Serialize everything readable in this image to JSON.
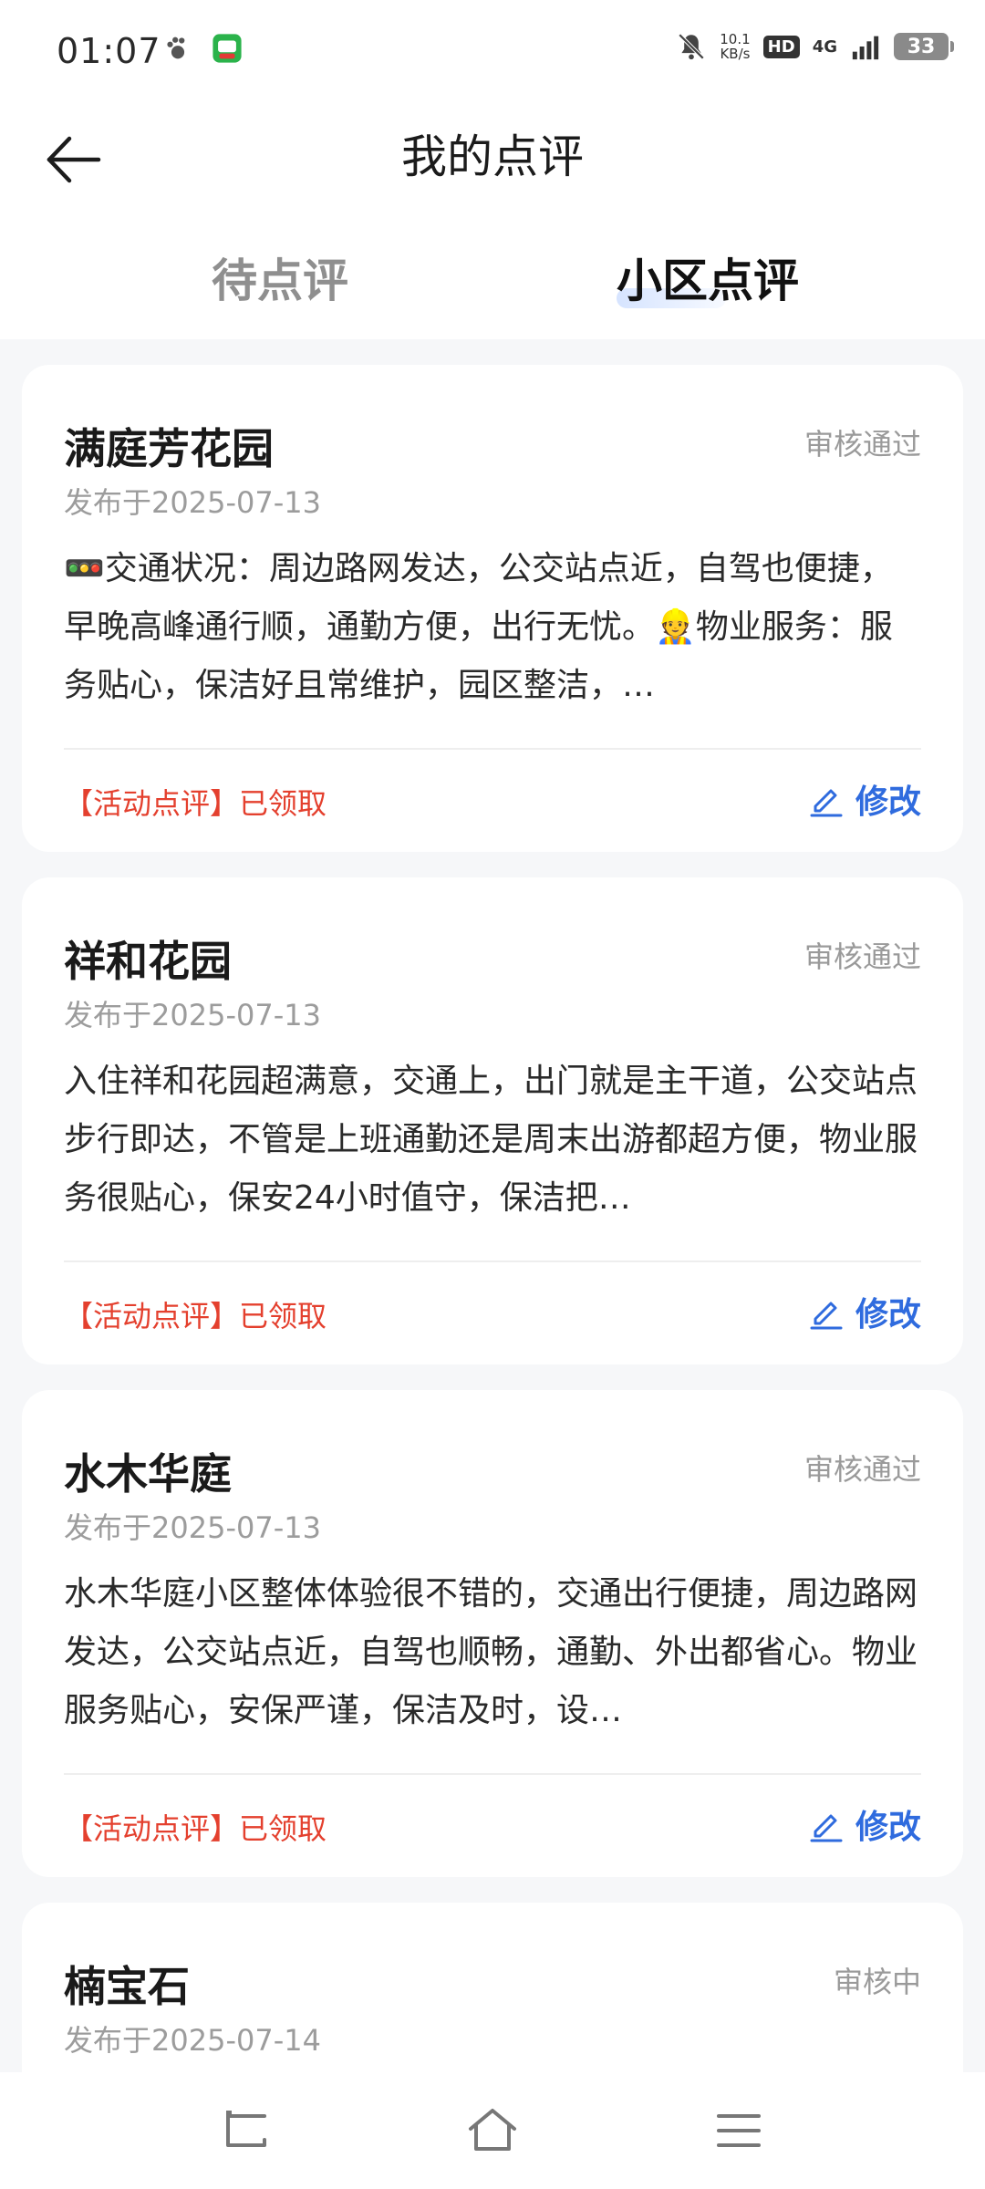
{
  "status_bar": {
    "time": "01:07",
    "speed_value": "10.1",
    "speed_unit": "KB/s",
    "hd": "HD",
    "network": "4G",
    "battery": "33"
  },
  "header": {
    "title": "我的点评"
  },
  "tabs": [
    {
      "label": "待点评",
      "active": false
    },
    {
      "label": "小区点评",
      "active": true
    }
  ],
  "reviews": [
    {
      "title": "满庭芳花园",
      "status": "审核通过",
      "date": "发布于2025-07-13",
      "text": "🚥交通状况：周边路网发达，公交站点近，自驾也便捷，早晚高峰通行顺，通勤方便，出行无忧。👷物业服务：服务贴心，保洁好且常维护，园区整洁，…",
      "activity": "【活动点评】已领取",
      "edit_label": "修改"
    },
    {
      "title": "祥和花园",
      "status": "审核通过",
      "date": "发布于2025-07-13",
      "text": "入住祥和花园超满意，交通上，出门就是主干道，公交站点步行即达，不管是上班通勤还是周末出游都超方便，物业服务很贴心，保安24小时值守，保洁把…",
      "activity": "【活动点评】已领取",
      "edit_label": "修改"
    },
    {
      "title": "水木华庭",
      "status": "审核通过",
      "date": "发布于2025-07-13",
      "text": "水木华庭小区整体体验很不错的，交通出行便捷，周边路网发达，公交站点近，自驾也顺畅，通勤、外出都省心。物业服务贴心，安保严谨，保洁及时，设…",
      "activity": "【活动点评】已领取",
      "edit_label": "修改"
    },
    {
      "title": "楠宝石",
      "status": "审核中",
      "date": "发布于2025-07-14",
      "text": "",
      "activity": "",
      "edit_label": ""
    }
  ],
  "colors": {
    "accent_blue": "#2f6bde",
    "activity_red": "#e4402e",
    "muted_gray": "#9a9a9a",
    "background": "#f6f7f9"
  },
  "icons": {
    "back": "arrow-left-icon",
    "edit": "pencil-icon",
    "nav_back": "back-nav-icon",
    "nav_home": "home-icon",
    "nav_menu": "menu-icon"
  }
}
